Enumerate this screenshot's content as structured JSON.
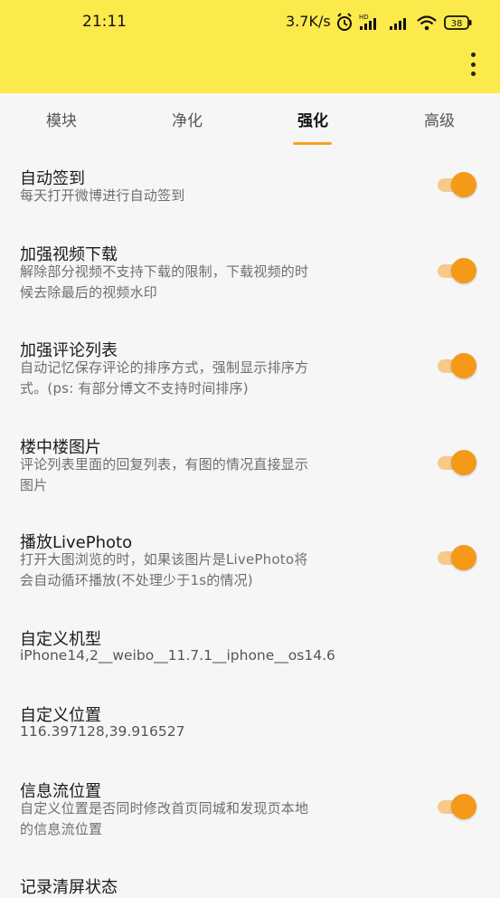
{
  "status_bar": {
    "time": "21:11",
    "network_speed": "3.7K/s",
    "battery": "38",
    "icons": [
      "alarm-icon",
      "hd-signal-icon",
      "signal-icon",
      "wifi-icon",
      "battery-icon"
    ]
  },
  "header": {
    "menu_icon": "more-vert-icon",
    "color": "#fce94b"
  },
  "tabs": [
    {
      "label": "模块",
      "active": false
    },
    {
      "label": "净化",
      "active": false
    },
    {
      "label": "强化",
      "active": true
    },
    {
      "label": "高级",
      "active": false
    }
  ],
  "settings": [
    {
      "title": "自动签到",
      "subtitle_lines": [
        "每天打开微博进行自动签到"
      ],
      "toggle": true
    },
    {
      "title": "加强视频下载",
      "subtitle_lines": [
        "解除部分视频不支持下载的限制，下载视频的时",
        "候去除最后的视频水印"
      ],
      "toggle": true
    },
    {
      "title": "加强评论列表",
      "subtitle_lines": [
        "自动记忆保存评论的排序方式，强制显示排序方",
        "式。(ps: 有部分博文不支持时间排序)"
      ],
      "toggle": true
    },
    {
      "title": "楼中楼图片",
      "subtitle_lines": [
        "评论列表里面的回复列表，有图的情况直接显示",
        "图片"
      ],
      "toggle": true
    },
    {
      "title": "播放LivePhoto",
      "subtitle_lines": [
        "打开大图浏览的时，如果该图片是LivePhoto将",
        "会自动循环播放(不处理少于1s的情况)"
      ],
      "toggle": true
    },
    {
      "title": "自定义机型",
      "value": "iPhone14,2__weibo__11.7.1__iphone__os14.6"
    },
    {
      "title": "自定义位置",
      "value": "116.397128,39.916527"
    },
    {
      "title": "信息流位置",
      "subtitle_lines": [
        "自定义位置是否同时修改首页同城和发现页本地",
        "的信息流位置"
      ],
      "toggle": true
    },
    {
      "title": "记录清屏状态"
    }
  ],
  "colors": {
    "accent": "#f49a18",
    "toggle_track": "#f7c98a",
    "background": "#f6f6f6"
  }
}
